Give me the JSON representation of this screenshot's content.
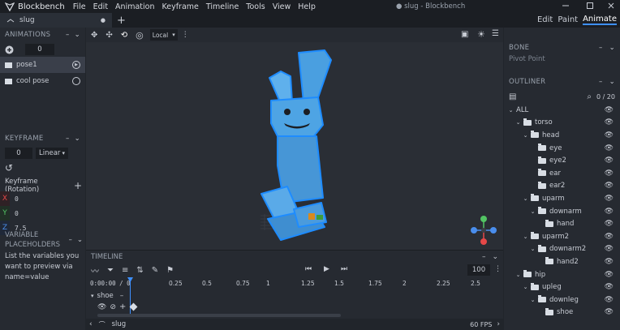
{
  "app": {
    "name": "Blockbench",
    "window_title": "● slug - Blockbench"
  },
  "menu": [
    "File",
    "Edit",
    "Animation",
    "Keyframe",
    "Timeline",
    "Tools",
    "View",
    "Help"
  ],
  "window_controls": [
    "minimize-icon",
    "maximize-icon",
    "close-icon"
  ],
  "tabs": [
    {
      "label": "slug",
      "modified": "●"
    }
  ],
  "modes": {
    "edit": "Edit",
    "paint": "Paint",
    "animate": "Animate",
    "active": "Animate"
  },
  "animations": {
    "title": "ANIMATIONS",
    "value": "0",
    "items": [
      {
        "label": "pose1",
        "selected": true,
        "playing": true
      },
      {
        "label": "cool pose",
        "selected": false,
        "playing": false
      }
    ]
  },
  "keyframe": {
    "title": "KEYFRAME",
    "time": "0",
    "interpolation": "Linear",
    "channel_label": "Keyframe (Rotation)",
    "x": "0",
    "y": "0",
    "z": "7.5",
    "axis_colors": {
      "x": "#e54848",
      "y": "#52c463",
      "z": "#4a8eed"
    }
  },
  "variable_placeholders": {
    "title": "VARIABLE PLACEHOLDERS",
    "text": "List the variables you want to preview via name=value"
  },
  "viewport": {
    "transform_space": "Local"
  },
  "bone": {
    "title": "BONE",
    "pivot": "Pivot Point"
  },
  "outliner": {
    "title": "OUTLINER",
    "count": "0 / 20",
    "items": [
      {
        "label": "ALL",
        "depth": 0,
        "folder": false,
        "open": true
      },
      {
        "label": "torso",
        "depth": 1,
        "folder": true,
        "open": true
      },
      {
        "label": "head",
        "depth": 2,
        "folder": true,
        "open": true
      },
      {
        "label": "eye",
        "depth": 3,
        "folder": true,
        "open": false
      },
      {
        "label": "eye2",
        "depth": 3,
        "folder": true,
        "open": false
      },
      {
        "label": "ear",
        "depth": 3,
        "folder": true,
        "open": false
      },
      {
        "label": "ear2",
        "depth": 3,
        "folder": true,
        "open": false
      },
      {
        "label": "uparm",
        "depth": 2,
        "folder": true,
        "open": true
      },
      {
        "label": "downarm",
        "depth": 3,
        "folder": true,
        "open": true
      },
      {
        "label": "hand",
        "depth": 4,
        "folder": true,
        "open": false
      },
      {
        "label": "uparm2",
        "depth": 2,
        "folder": true,
        "open": true
      },
      {
        "label": "downarm2",
        "depth": 3,
        "folder": true,
        "open": true
      },
      {
        "label": "hand2",
        "depth": 4,
        "folder": true,
        "open": false
      },
      {
        "label": "hip",
        "depth": 1,
        "folder": true,
        "open": true
      },
      {
        "label": "upleg",
        "depth": 2,
        "folder": true,
        "open": true
      },
      {
        "label": "downleg",
        "depth": 3,
        "folder": true,
        "open": true
      },
      {
        "label": "shoe",
        "depth": 4,
        "folder": true,
        "open": false
      }
    ]
  },
  "timeline": {
    "title": "TIMELINE",
    "time": "0:00:00 / 0",
    "ticks": [
      "0.25",
      "0.5",
      "0.75",
      "1",
      "1.25",
      "1.5",
      "1.75",
      "2",
      "2.25",
      "2.5"
    ],
    "speed": "100",
    "track_name": "shoe"
  },
  "status": {
    "model": "slug",
    "fps": "60 FPS"
  },
  "colors": {
    "accent": "#3e90ff",
    "selection": "#3a3f4a",
    "model": "#4a9fe0"
  }
}
